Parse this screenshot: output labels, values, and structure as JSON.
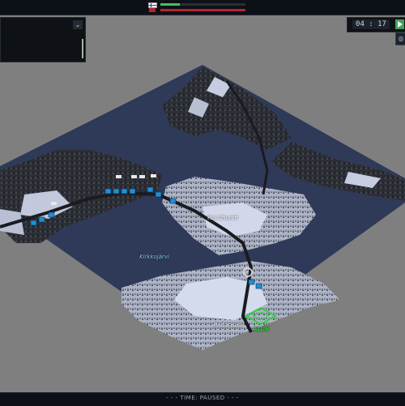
{
  "top_bar": {
    "flag_top": "finnish-flag-icon",
    "flag_bottom": "red-flag-icon",
    "bar_top": {
      "progress": 0.23,
      "color": "#3ec45c"
    },
    "bar_bottom": {
      "progress": 1.0,
      "color": "#b3262e"
    }
  },
  "left_panel": {
    "dropdown_icon": "chevron-down-icon",
    "dropdown_glyph": "⌄"
  },
  "clock": {
    "time": "04 : 17",
    "play_icon": "play-icon",
    "speed_glyph": "◎"
  },
  "map": {
    "labels": {
      "church": "Ruj Church",
      "lake": "Kirkkojärvi",
      "village": "Radansuo",
      "objective": "ALUE"
    },
    "colors": {
      "water": "#2f3a58",
      "land": "#3c3e46",
      "snow": "#cfd6ea",
      "friendly_unit": "#1e8fd8",
      "objective": "#30d040"
    }
  },
  "status_bar": {
    "text": "- - -   TIME: PAUSED   - - -"
  }
}
